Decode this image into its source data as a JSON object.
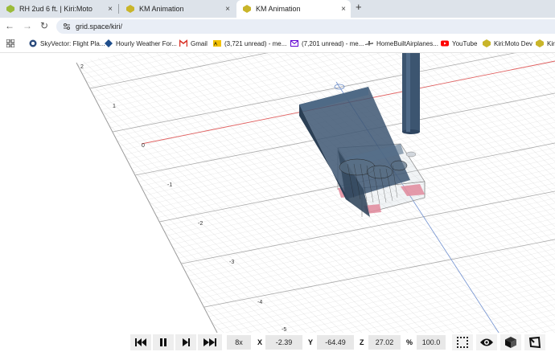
{
  "browser": {
    "tabs": [
      {
        "title": "RH 2ud 6 ft. | Kiri:Moto",
        "icon": "kirimoto-favicon",
        "active": false
      },
      {
        "title": "KM Animation",
        "icon": "kirimoto-favicon",
        "active": false
      },
      {
        "title": "KM Animation",
        "icon": "kirimoto-favicon",
        "active": true
      }
    ],
    "tab_close": "×",
    "new_tab": "+",
    "url": "grid.space/kiri/",
    "nav": {
      "back": "←",
      "forward": "→",
      "reload": "↻"
    }
  },
  "bookmarks": [
    {
      "label": "",
      "icon": "apps-grid-icon"
    },
    {
      "label": "SkyVector: Flight Pla...",
      "icon": "skyvector-icon"
    },
    {
      "label": "Hourly Weather For...",
      "icon": "weather-icon"
    },
    {
      "label": "Gmail",
      "icon": "gmail-icon"
    },
    {
      "label": "(3,721 unread) - me...",
      "icon": "aol-mail-icon"
    },
    {
      "label": "(7,201 unread) - me...",
      "icon": "yahoo-mail-icon"
    },
    {
      "label": "HomeBuiltAirplanes...",
      "icon": "homebuilt-icon"
    },
    {
      "label": "YouTube",
      "icon": "youtube-icon"
    },
    {
      "label": "Kiri:Moto Dev",
      "icon": "kirimoto-favicon"
    },
    {
      "label": "Kiri",
      "icon": "kirimoto-favicon"
    }
  ],
  "viewport": {
    "axis_labels": [
      "2",
      "1",
      "0",
      "-1",
      "-2",
      "-3",
      "-4",
      "-5"
    ]
  },
  "controls": {
    "buttons": [
      {
        "name": "skip-start-button",
        "icon": "skip-start-icon"
      },
      {
        "name": "pause-button",
        "icon": "pause-icon"
      },
      {
        "name": "step-forward-button",
        "icon": "step-forward-icon"
      },
      {
        "name": "fast-forward-button",
        "icon": "fast-forward-icon"
      }
    ],
    "speed": "8x",
    "x_label": "X",
    "x_value": "-2.39",
    "y_label": "Y",
    "y_value": "-64.49",
    "z_label": "Z",
    "z_value": "27.02",
    "pct_label": "%",
    "pct_value": "100.0",
    "view_icons": [
      "dots-grid-icon",
      "eye-icon",
      "cube-solid-icon",
      "cube-outline-icon"
    ],
    "colors": {
      "stock": "#2f4864",
      "clamp": "#e28a9c",
      "tool": "#3c5570"
    }
  }
}
